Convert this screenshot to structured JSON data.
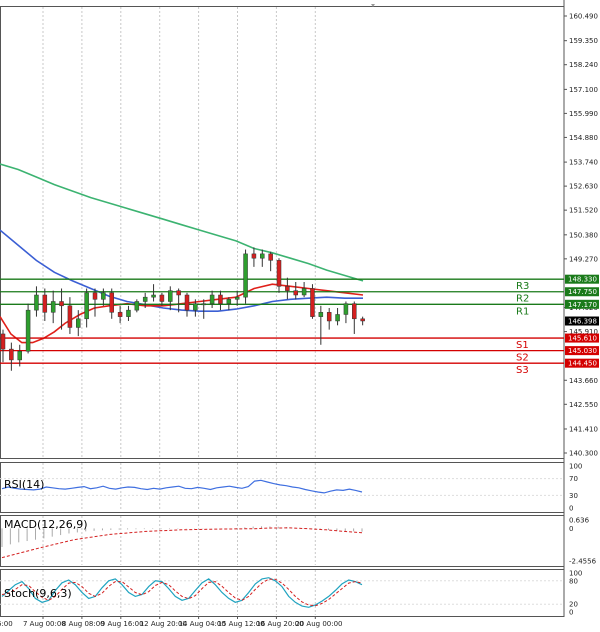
{
  "chart_data": {
    "type": "candlestick",
    "timeframe_axis": [
      "7 Aug 00:00",
      "8 Aug 08:00",
      "9 Aug 16:00",
      "12 Aug 20:00",
      "14 Aug 04:00",
      "15 Aug 12:00",
      "16 Aug 20:00",
      "20 Aug 00:00"
    ],
    "first_axis_partial": "6:00",
    "price_ticks": [
      "160.490",
      "159.350",
      "158.240",
      "157.100",
      "155.990",
      "154.880",
      "153.740",
      "152.630",
      "151.520",
      "150.380",
      "149.270",
      "147.020",
      "145.910",
      "143.660",
      "142.550",
      "141.410",
      "140.300"
    ],
    "price_range": [
      140.3,
      160.49
    ],
    "current_price": "146.398",
    "levels": [
      {
        "name": "R3",
        "value": 148.33,
        "label": "148.330",
        "color": "#1a7a1a"
      },
      {
        "name": "R2",
        "value": 147.75,
        "label": "147.750",
        "color": "#1a7a1a"
      },
      {
        "name": "R1",
        "value": 147.17,
        "label": "147.170",
        "color": "#1a7a1a"
      },
      {
        "name": "S1",
        "value": 145.61,
        "label": "145.610",
        "color": "#d40000"
      },
      {
        "name": "S2",
        "value": 145.03,
        "label": "145.030",
        "color": "#d40000"
      },
      {
        "name": "S3",
        "value": 144.45,
        "label": "144.450",
        "color": "#d40000"
      }
    ],
    "candles": [
      [
        145.8,
        145.1,
        146.0,
        144.5
      ],
      [
        145.1,
        144.6,
        145.4,
        144.1
      ],
      [
        144.6,
        145.0,
        145.3,
        144.3
      ],
      [
        145.0,
        146.9,
        147.2,
        144.9
      ],
      [
        146.9,
        147.6,
        148.0,
        146.6
      ],
      [
        147.6,
        146.8,
        147.9,
        146.4
      ],
      [
        146.8,
        147.3,
        147.8,
        146.3
      ],
      [
        147.3,
        147.1,
        147.9,
        146.0
      ],
      [
        147.1,
        146.1,
        147.5,
        145.8
      ],
      [
        146.1,
        146.5,
        146.9,
        145.7
      ],
      [
        146.5,
        147.7,
        147.9,
        146.1
      ],
      [
        147.7,
        147.4,
        147.9,
        146.6
      ],
      [
        147.4,
        147.7,
        147.9,
        147.1
      ],
      [
        147.7,
        146.8,
        147.9,
        146.5
      ],
      [
        146.8,
        146.6,
        147.1,
        146.3
      ],
      [
        146.6,
        146.9,
        147.1,
        146.4
      ],
      [
        146.9,
        147.3,
        147.4,
        146.8
      ],
      [
        147.3,
        147.5,
        147.7,
        147.0
      ],
      [
        147.5,
        147.6,
        148.1,
        147.3
      ],
      [
        147.6,
        147.3,
        147.7,
        147.1
      ],
      [
        147.3,
        147.8,
        148.0,
        146.9
      ],
      [
        147.8,
        147.6,
        147.9,
        146.8
      ],
      [
        147.6,
        146.9,
        147.7,
        146.6
      ],
      [
        146.9,
        147.2,
        147.4,
        146.6
      ],
      [
        147.2,
        147.2,
        147.4,
        146.5
      ],
      [
        147.2,
        147.6,
        147.8,
        147.0
      ],
      [
        147.6,
        147.2,
        147.8,
        146.9
      ],
      [
        147.2,
        147.4,
        147.5,
        146.9
      ],
      [
        147.4,
        147.5,
        147.8,
        147.1
      ],
      [
        147.5,
        149.5,
        149.7,
        147.2
      ],
      [
        149.5,
        149.3,
        149.8,
        148.9
      ],
      [
        149.3,
        149.5,
        149.7,
        148.9
      ],
      [
        149.5,
        149.2,
        149.6,
        148.7
      ],
      [
        149.2,
        148.0,
        149.3,
        147.7
      ],
      [
        148.0,
        147.8,
        148.4,
        147.4
      ],
      [
        147.8,
        147.6,
        148.2,
        147.4
      ],
      [
        147.6,
        147.9,
        148.2,
        147.5
      ],
      [
        147.9,
        146.6,
        148.1,
        146.5
      ],
      [
        146.6,
        146.8,
        147.1,
        145.3
      ],
      [
        146.8,
        146.4,
        147.0,
        146.0
      ],
      [
        146.4,
        146.7,
        147.0,
        146.2
      ],
      [
        146.7,
        147.2,
        147.3,
        146.3
      ],
      [
        147.2,
        146.5,
        147.3,
        145.8
      ],
      [
        146.5,
        146.4,
        146.6,
        146.2
      ]
    ],
    "ma_slow": [
      [
        0,
        153.65
      ],
      [
        0.05,
        153.4
      ],
      [
        0.1,
        153.05
      ],
      [
        0.15,
        152.7
      ],
      [
        0.2,
        152.4
      ],
      [
        0.25,
        152.1
      ],
      [
        0.3,
        151.85
      ],
      [
        0.35,
        151.6
      ],
      [
        0.4,
        151.35
      ],
      [
        0.45,
        151.1
      ],
      [
        0.5,
        150.85
      ],
      [
        0.55,
        150.6
      ],
      [
        0.6,
        150.35
      ],
      [
        0.65,
        150.1
      ],
      [
        0.7,
        149.75
      ],
      [
        0.75,
        149.55
      ],
      [
        0.8,
        149.3
      ],
      [
        0.85,
        149.05
      ],
      [
        0.9,
        148.75
      ],
      [
        0.95,
        148.5
      ],
      [
        1.0,
        148.25
      ]
    ],
    "ma_mid": [
      [
        0,
        150.6
      ],
      [
        0.05,
        149.9
      ],
      [
        0.1,
        149.2
      ],
      [
        0.15,
        148.65
      ],
      [
        0.2,
        148.25
      ],
      [
        0.25,
        147.9
      ],
      [
        0.3,
        147.55
      ],
      [
        0.35,
        147.3
      ],
      [
        0.4,
        147.15
      ],
      [
        0.45,
        147.0
      ],
      [
        0.5,
        146.9
      ],
      [
        0.55,
        146.85
      ],
      [
        0.6,
        146.85
      ],
      [
        0.65,
        146.95
      ],
      [
        0.7,
        147.1
      ],
      [
        0.75,
        147.3
      ],
      [
        0.8,
        147.4
      ],
      [
        0.85,
        147.45
      ],
      [
        0.9,
        147.5
      ],
      [
        0.95,
        147.45
      ],
      [
        1.0,
        147.45
      ]
    ],
    "ma_fast": [
      [
        0,
        146.6
      ],
      [
        0.03,
        145.8
      ],
      [
        0.06,
        145.4
      ],
      [
        0.09,
        145.4
      ],
      [
        0.12,
        145.6
      ],
      [
        0.15,
        145.9
      ],
      [
        0.18,
        146.3
      ],
      [
        0.22,
        146.7
      ],
      [
        0.26,
        147.0
      ],
      [
        0.3,
        147.1
      ],
      [
        0.35,
        147.2
      ],
      [
        0.4,
        147.1
      ],
      [
        0.45,
        147.1
      ],
      [
        0.5,
        147.2
      ],
      [
        0.55,
        147.3
      ],
      [
        0.6,
        147.4
      ],
      [
        0.65,
        147.5
      ],
      [
        0.7,
        147.9
      ],
      [
        0.75,
        148.1
      ],
      [
        0.8,
        148.0
      ],
      [
        0.85,
        147.9
      ],
      [
        0.9,
        147.8
      ],
      [
        0.95,
        147.7
      ],
      [
        1.0,
        147.6
      ]
    ],
    "rsi": {
      "label": "RSI(14)",
      "ticks": [
        "100",
        "70",
        "30",
        "0"
      ],
      "range": [
        0,
        100
      ],
      "values": [
        46,
        50,
        47,
        45,
        44,
        43,
        45,
        50,
        48,
        46,
        45,
        47,
        49,
        51,
        46,
        48,
        52,
        47,
        45,
        48,
        50,
        49,
        46,
        44,
        47,
        45,
        48,
        50,
        52,
        47,
        46,
        49,
        47,
        44,
        48,
        50,
        52,
        49,
        47,
        51,
        64,
        66,
        62,
        58,
        55,
        53,
        50,
        48,
        44,
        41,
        38,
        36,
        40,
        43,
        42,
        45,
        42,
        38
      ]
    },
    "macd": {
      "label": "MACD(12,26,9)",
      "ticks": [
        "0.636",
        "0",
        "-2.4556"
      ],
      "range": [
        -2.4556,
        0.636
      ],
      "histogram": [
        -1.4,
        -1.2,
        -1.05,
        -0.95,
        -0.85,
        -0.75,
        -0.62,
        -0.5,
        -0.38,
        -0.3,
        -0.22,
        -0.18,
        -0.14,
        -0.11,
        -0.09,
        -0.07,
        -0.06,
        -0.05,
        -0.04,
        -0.05,
        -0.04,
        -0.03,
        -0.02,
        -0.02,
        -0.02,
        -0.01,
        -0.01,
        -0.01,
        0.02,
        0.08,
        0.14,
        0.16,
        0.15,
        0.13,
        0.1,
        0.06,
        0.02,
        -0.03,
        -0.08,
        -0.12,
        -0.16,
        -0.2,
        -0.22,
        -0.24
      ],
      "signal": [
        [
          0,
          -2.2
        ],
        [
          0.1,
          -1.5
        ],
        [
          0.2,
          -0.85
        ],
        [
          0.3,
          -0.45
        ],
        [
          0.4,
          -0.22
        ],
        [
          0.5,
          -0.1
        ],
        [
          0.6,
          -0.05
        ],
        [
          0.7,
          -0.02
        ],
        [
          0.75,
          0.03
        ],
        [
          0.8,
          0.04
        ],
        [
          0.85,
          -0.02
        ],
        [
          0.9,
          -0.1
        ],
        [
          0.95,
          -0.22
        ],
        [
          1.0,
          -0.32
        ]
      ]
    },
    "stoch": {
      "label": "Stoch(9,6,3)",
      "ticks": [
        "100",
        "80",
        "20",
        "0"
      ],
      "range": [
        0,
        100
      ],
      "main": [
        40,
        55,
        70,
        78,
        60,
        35,
        25,
        30,
        55,
        75,
        82,
        70,
        50,
        35,
        40,
        62,
        80,
        85,
        70,
        50,
        40,
        45,
        65,
        80,
        78,
        60,
        40,
        30,
        35,
        55,
        75,
        85,
        70,
        50,
        35,
        25,
        30,
        50,
        72,
        85,
        88,
        80,
        65,
        40,
        25,
        15,
        12,
        18,
        28,
        40,
        55,
        72,
        82,
        78,
        70
      ],
      "signal": [
        45,
        48,
        58,
        70,
        68,
        52,
        38,
        30,
        40,
        58,
        74,
        76,
        65,
        48,
        40,
        48,
        66,
        78,
        78,
        64,
        50,
        44,
        52,
        68,
        76,
        70,
        54,
        40,
        34,
        42,
        60,
        76,
        78,
        66,
        50,
        36,
        30,
        40,
        58,
        74,
        84,
        84,
        74,
        58,
        40,
        26,
        18,
        16,
        22,
        32,
        46,
        60,
        74,
        78,
        74
      ]
    }
  }
}
